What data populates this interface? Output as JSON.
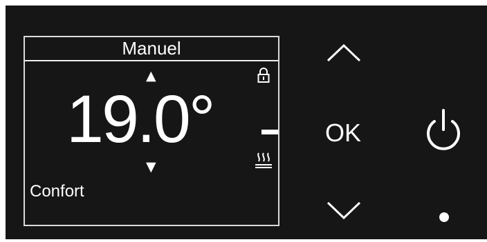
{
  "display": {
    "mode_title": "Manuel",
    "setpoint": "19.0°",
    "preset": "Confort",
    "up_indicator": "▲",
    "down_indicator": "▼",
    "icons": {
      "lock": "lock-icon",
      "dash": "dash-indicator",
      "heating": "heating-waves-icon"
    }
  },
  "controls": {
    "up_icon": "chevron-up-icon",
    "ok_label": "OK",
    "down_icon": "chevron-down-icon",
    "power_icon": "power-icon",
    "status_indicator": "dot"
  },
  "colors": {
    "panel_background": "#161616",
    "foreground": "#ffffff",
    "screen_border": "#dcdcdc"
  }
}
